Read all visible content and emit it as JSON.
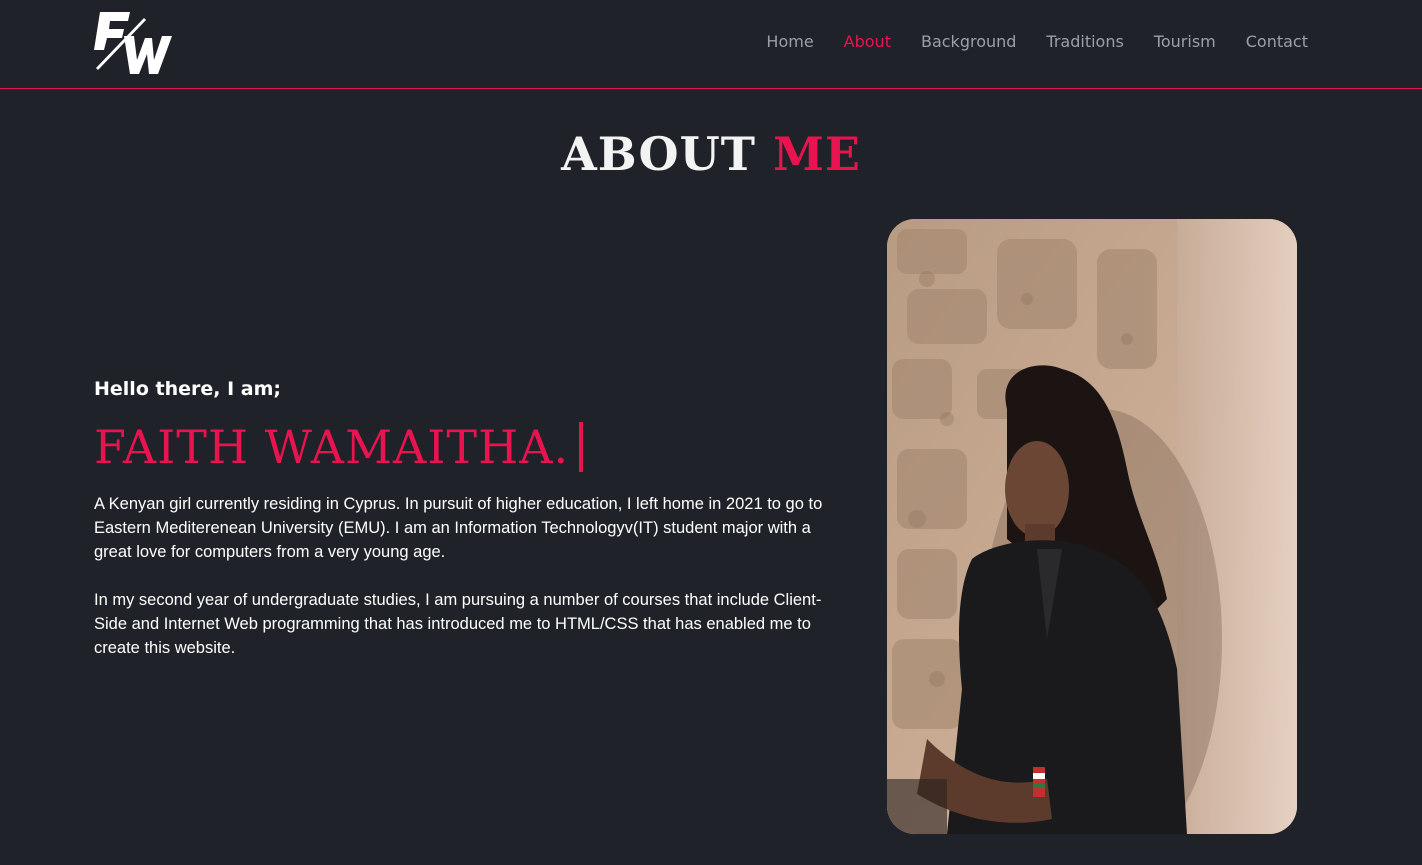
{
  "header": {
    "logo_alt": "FW logo",
    "nav": [
      {
        "label": "Home"
      },
      {
        "label": "About"
      },
      {
        "label": "Background"
      },
      {
        "label": "Traditions"
      },
      {
        "label": "Tourism"
      },
      {
        "label": "Contact"
      }
    ],
    "active": "About"
  },
  "main": {
    "title_part1": "ABOUT",
    "title_part2": "ME",
    "greeting": "Hello there, I am;",
    "name": "FAITH WAMAITHA.",
    "paragraphs": [
      "A Kenyan girl currently residing in Cyprus. In pursuit of higher education, I left home in 2021 to go to Eastern Mediterenean University (EMU). I am an Information Technologyv(IT) student major with a great love for computers from a very young age.",
      "In my second year of undergraduate studies, I am pursuing a number of courses that include Client-Side and Internet Web programming that has introduced me to HTML/CSS that has enabled me to create this website."
    ],
    "photo_alt": "Portrait of Faith Wamaitha"
  },
  "colors": {
    "background": "#1f2228",
    "accent": "#e8134f",
    "nav_text": "#9aa0a8",
    "text": "#ffffff"
  }
}
